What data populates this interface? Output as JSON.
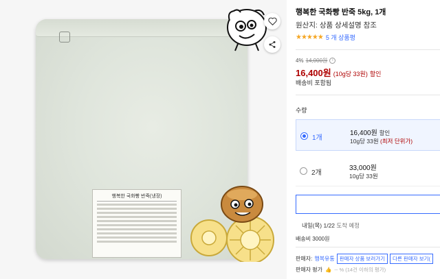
{
  "product_image": {
    "label_title": "행복한 국화빵 반죽(냉장)"
  },
  "actions": {
    "favorite_icon": "heart-icon",
    "share_icon": "share-icon"
  },
  "product": {
    "title": "행복한 국화빵 반죽 5kg, 1개",
    "origin": "원산지: 상품 상세설명 참조",
    "rating_stars": 4.5,
    "review_count": "5 개 상품평"
  },
  "pricing": {
    "discount": "4%",
    "original_price": "14,000원",
    "price": "16,400원",
    "unit_price": "(10g당 33원)",
    "sale_tag": "할인",
    "shipping": "배송비 포함됨"
  },
  "quantity": {
    "label": "수량",
    "options": [
      {
        "qty": "1개",
        "price": "16,400원",
        "tag": "할인",
        "unit": "10g당 33원",
        "note": "(최저 단위가)",
        "selected": true
      },
      {
        "qty": "2개",
        "price": "33,000원",
        "tag": "",
        "unit": "10g당 33원",
        "note": "",
        "selected": false
      }
    ]
  },
  "delivery": {
    "date": "내일(목) 1/22",
    "suffix": "도착 예정",
    "shipping_fee": "배송비 3000원"
  },
  "seller": {
    "label": "판매자:",
    "name": "행복유통",
    "view_products_button": "판매자 상품 보러가기",
    "other_seller_button": "다른 판매자 보기(",
    "rating_label": "판매자 평가",
    "rating_text": "-- % (14건 이하의 평가)"
  },
  "colors": {
    "accent_blue": "#346aff",
    "price_red": "#ae0000",
    "star_gold": "#f5a623"
  }
}
